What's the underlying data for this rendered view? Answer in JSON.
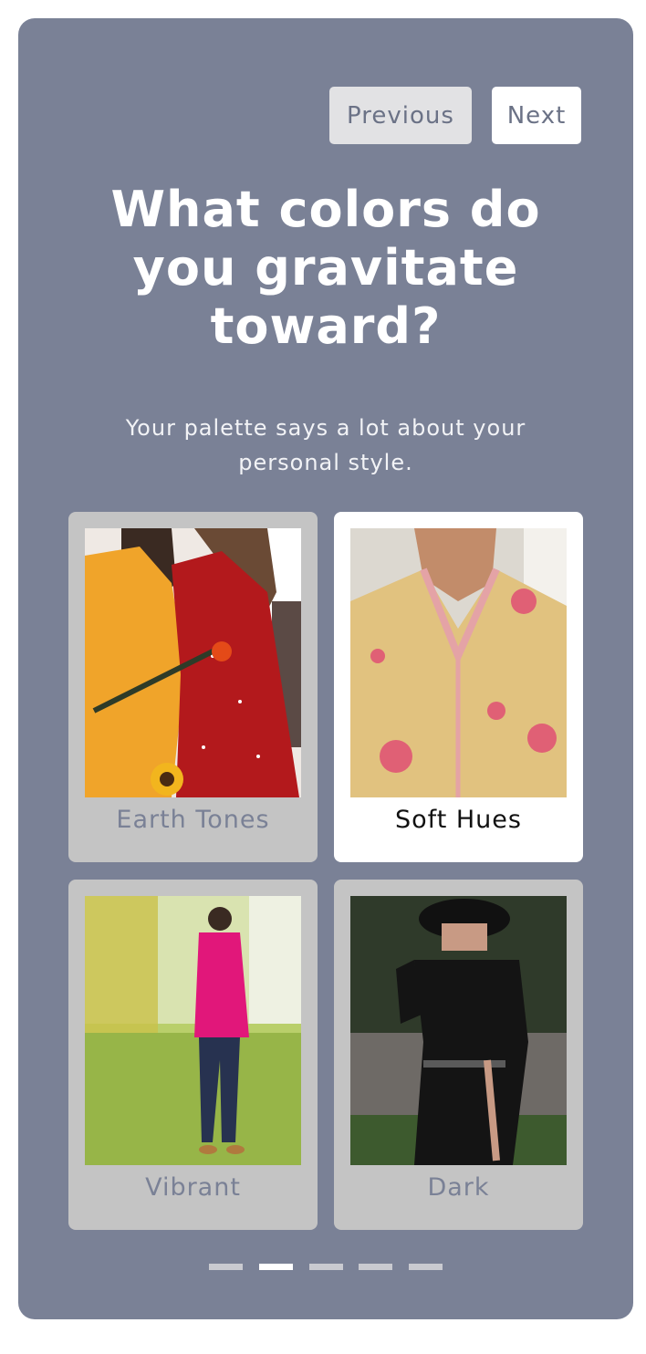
{
  "nav": {
    "previous_label": "Previous",
    "next_label": "Next"
  },
  "question": {
    "title": "What colors do you gravitate toward?",
    "subtitle": "Your palette says a lot about your personal style."
  },
  "options": [
    {
      "label": "Earth Tones",
      "selected": false
    },
    {
      "label": "Soft Hues",
      "selected": true
    },
    {
      "label": "Vibrant",
      "selected": false
    },
    {
      "label": "Dark",
      "selected": false
    }
  ],
  "pagination": {
    "total": 5,
    "current": 2
  },
  "colors": {
    "card_background": "#7a8196",
    "option_background": "#c4c4c4",
    "option_selected_background": "#ffffff",
    "indicator_inactive": "#c9cad0",
    "indicator_active": "#ffffff"
  }
}
